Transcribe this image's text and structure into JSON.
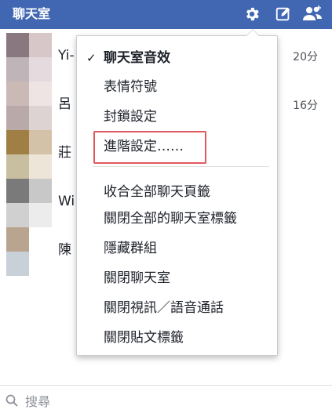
{
  "header": {
    "title": "聊天室",
    "icons": [
      "gear-icon",
      "compose-icon",
      "group-icon"
    ],
    "background": "#4267b2"
  },
  "contacts": [
    {
      "name": "Yi-",
      "time": "20分",
      "avatar_colors": [
        "#8a7880",
        "#d8c7c9",
        "#bfb4b8",
        "#e5dadd"
      ]
    },
    {
      "name": "呂",
      "time": "16分",
      "avatar_colors": [
        "#cbb9b6",
        "#eee4e4",
        "#b9a9a9",
        "#ddd3d3"
      ]
    },
    {
      "name": "莊",
      "time": "",
      "avatar_colors": [
        "#a07f45",
        "#d4c2a8",
        "#c8bfa0",
        "#ede5d8"
      ]
    },
    {
      "name": "Wi",
      "time": "",
      "avatar_colors": [
        "#7a7a7a",
        "#c8c8c8",
        "#d0d0d0",
        "#ececec"
      ]
    },
    {
      "name": "陳",
      "time": "",
      "avatar_colors": [
        "#b8a48f",
        "#ffffff",
        "#c8d0d8",
        "#ffffff"
      ]
    }
  ],
  "menu": {
    "items": [
      {
        "label": "聊天室音效",
        "checked": true,
        "bold": true
      },
      {
        "label": "表情符號"
      },
      {
        "label": "封鎖設定"
      },
      {
        "label": "進階設定……",
        "highlighted": true
      },
      {
        "label": "收合全部聊天頁籤"
      },
      {
        "label": "關閉全部的聊天室標籤"
      },
      {
        "label": "隱藏群組"
      },
      {
        "label": "關閉聊天室"
      },
      {
        "label": "關閉視訊／語音通話"
      },
      {
        "label": "關閉貼文標籤"
      }
    ],
    "check_glyph": "✓",
    "highlight_color": "#e0585e"
  },
  "search": {
    "placeholder": "搜尋",
    "value": ""
  }
}
